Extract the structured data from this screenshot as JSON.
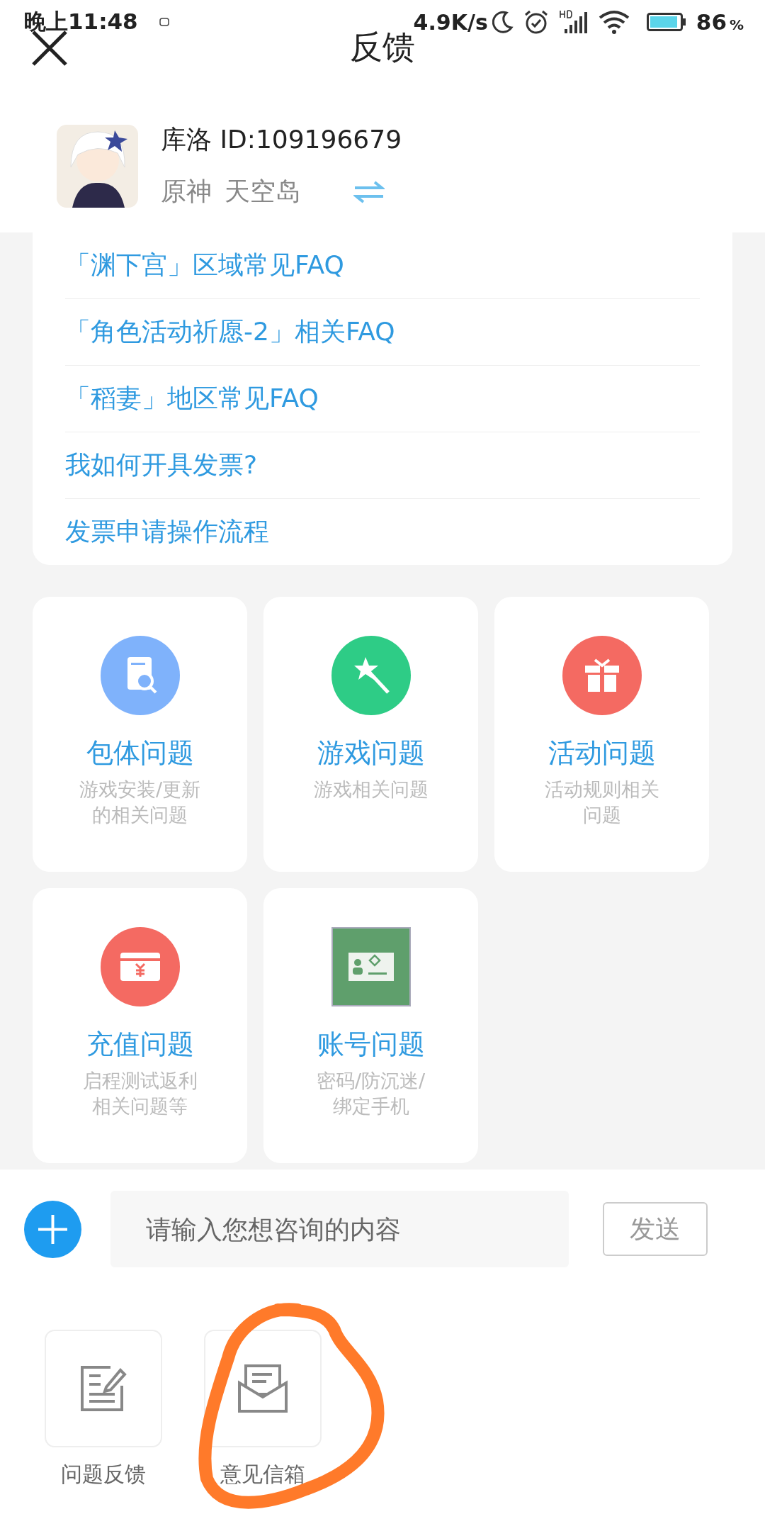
{
  "status_bar": {
    "time": "晚上11:48",
    "net_speed": "4.9K/s",
    "battery": "86",
    "battery_unit": "%"
  },
  "header": {
    "title": "反馈"
  },
  "account": {
    "name": "库洛 ID:109196679",
    "game": "原神",
    "server": "天空岛"
  },
  "faq": [
    "「渊下宫」区域常见FAQ",
    "「角色活动祈愿-2」相关FAQ",
    "「稻妻」地区常见FAQ",
    "我如何开具发票?",
    "发票申请操作流程"
  ],
  "categories": [
    {
      "kind": "doc-search",
      "color": "#7fb2fb",
      "title": "包体问题",
      "desc": "游戏安装/更新的相关问题"
    },
    {
      "kind": "wand",
      "color": "#2ecc86",
      "title": "游戏问题",
      "desc": "游戏相关问题"
    },
    {
      "kind": "gift",
      "color": "#f46a62",
      "title": "活动问题",
      "desc": "活动规则相关问题"
    },
    {
      "kind": "card",
      "color": "#f46a62",
      "title": "充值问题",
      "desc": "启程测试返利相关问题等"
    },
    {
      "kind": "id",
      "color": "#5f9f6c",
      "title": "账号问题",
      "desc": "密码/防沉迷/绑定手机"
    }
  ],
  "composer": {
    "placeholder": "请输入您想咨询的内容",
    "send": "发送"
  },
  "tools": [
    {
      "kind": "note",
      "label": "问题反馈"
    },
    {
      "kind": "mail",
      "label": "意见信箱"
    }
  ],
  "annotation": {
    "kind": "circle"
  }
}
